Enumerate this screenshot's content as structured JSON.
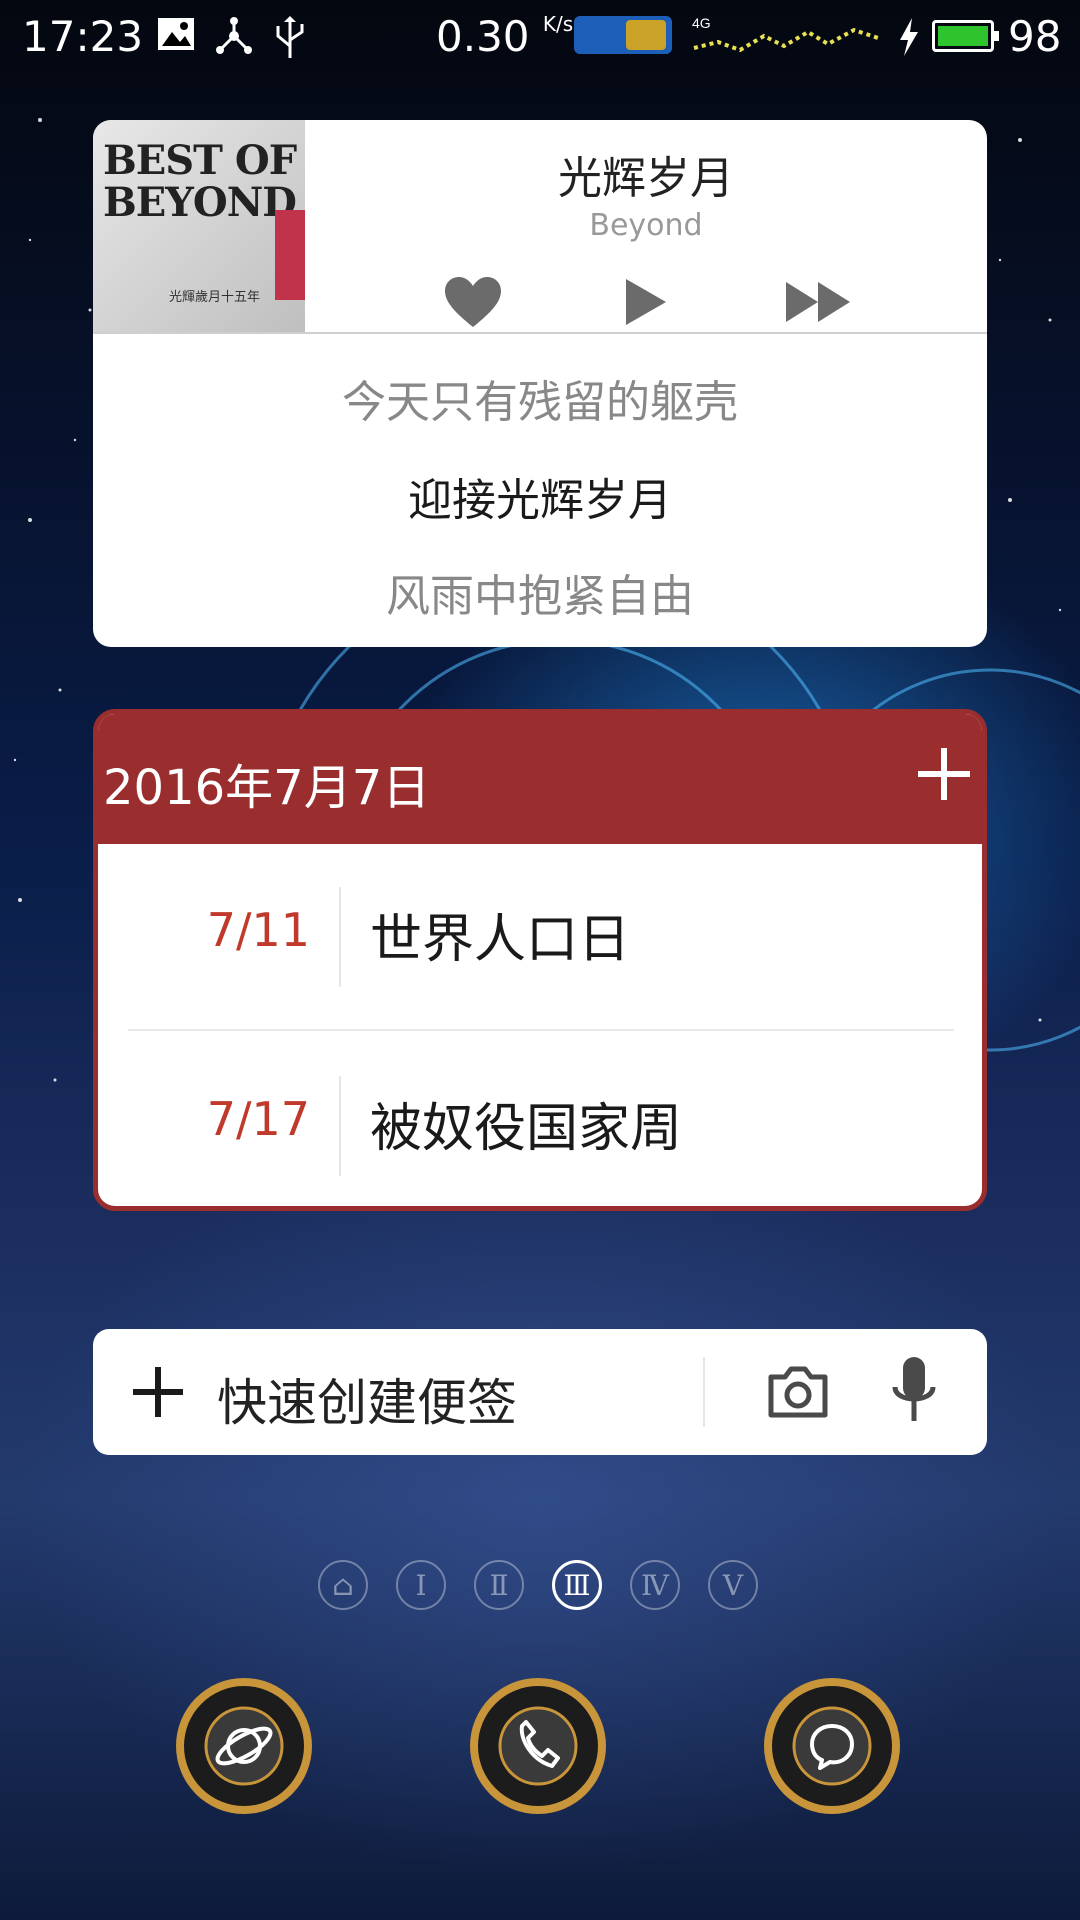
{
  "status_bar": {
    "time": "17:23",
    "net_speed": "0.30",
    "net_speed_unit": "K/s",
    "battery_percent": "98",
    "battery_color": "#2ec42e",
    "icons": [
      "image-icon",
      "usb-debug-icon",
      "usb-icon",
      "app-logo-icon",
      "signal-4g-icon",
      "charging-icon",
      "battery-icon"
    ]
  },
  "music_widget": {
    "album_cover_text": "BEST OF BEYOND",
    "album_cover_subtitle": "光輝歲月十五年",
    "song_title": "光辉岁月",
    "artist": "Beyond",
    "controls": [
      "heart-icon",
      "play-icon",
      "fast-forward-icon"
    ],
    "lyrics": [
      "今天只有残留的躯壳",
      "迎接光辉岁月",
      "风雨中抱紧自由"
    ]
  },
  "calendar_widget": {
    "date": "2016年7月7日",
    "accent_color": "#9a2e2e",
    "events": [
      {
        "date": "7/11",
        "title": "世界人口日"
      },
      {
        "date": "7/17",
        "title": "被奴役国家周"
      }
    ]
  },
  "note_widget": {
    "label": "快速创建便签"
  },
  "page_indicator": {
    "pages": [
      "⌂",
      "Ⅰ",
      "Ⅱ",
      "Ⅲ",
      "Ⅳ",
      "Ⅴ"
    ],
    "active_index": 3
  },
  "dock": {
    "apps": [
      "browser-icon",
      "phone-icon",
      "messages-icon"
    ]
  }
}
